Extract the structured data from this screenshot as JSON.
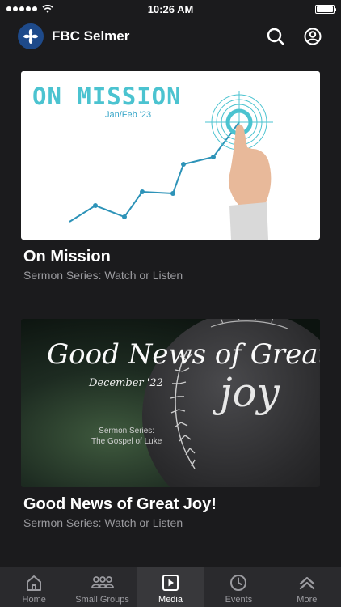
{
  "status_bar": {
    "time": "10:26 AM",
    "battery_level": 1.0
  },
  "header": {
    "title": "FBC Selmer",
    "logo_icon": "flower-icon"
  },
  "cards": [
    {
      "image": {
        "headline": "ON MISSION",
        "issue": "Jan/Feb '23"
      },
      "title": "On Mission",
      "subtitle": "Sermon Series: Watch or Listen"
    },
    {
      "image": {
        "script_title": "Good News of Great",
        "date": "December '22",
        "joy": "joy",
        "series_line1": "Sermon Series:",
        "series_line2": "The Gospel of Luke"
      },
      "title": "Good News of Great Joy!",
      "subtitle": "Sermon Series: Watch or Listen"
    }
  ],
  "tabs": [
    {
      "label": "Home",
      "icon": "home-icon"
    },
    {
      "label": "Small Groups",
      "icon": "group-icon"
    },
    {
      "label": "Media",
      "icon": "play-icon",
      "active": true
    },
    {
      "label": "Events",
      "icon": "clock-icon"
    },
    {
      "label": "More",
      "icon": "chevron-up-icon"
    }
  ],
  "colors": {
    "background": "#1b1b1d",
    "tab_bar": "#2a2a2d",
    "accent_teal": "#4bc3d0",
    "logo_blue": "#1e4a8a"
  }
}
